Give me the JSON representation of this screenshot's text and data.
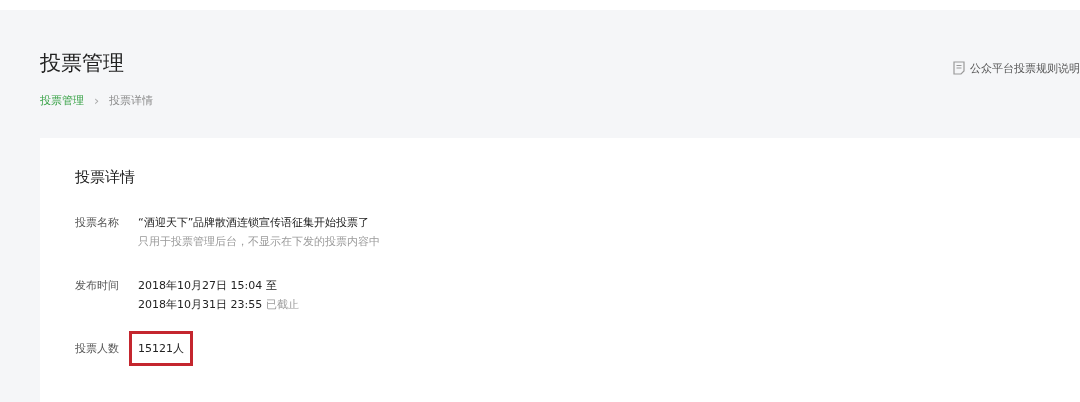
{
  "page_title": "投票管理",
  "breadcrumb": [
    {
      "label": "投票管理",
      "selected": false
    },
    {
      "label": "投票详情",
      "selected": true
    }
  ],
  "breadcrumb_separator": "›",
  "rules_link": "公众平台投票规则说明",
  "card": {
    "title": "投票详情",
    "fields": [
      {
        "label": "投票名称",
        "lines": [
          {
            "text": "“酒迎天下”品牌散酒连锁宣传语征集开始投票了"
          }
        ],
        "hint": "只用于投票管理后台，不显示在下发的投票内容中",
        "highlighted": false
      },
      {
        "label": "发布时间",
        "lines": [
          {
            "text": "2018年10月27日 15:04 至"
          },
          {
            "text": "2018年10月31日 23:55",
            "suffix": "已截止"
          }
        ],
        "highlighted": false
      },
      {
        "label": "投票人数",
        "lines": [
          {
            "text": "15121人"
          }
        ],
        "highlighted": true
      }
    ]
  }
}
